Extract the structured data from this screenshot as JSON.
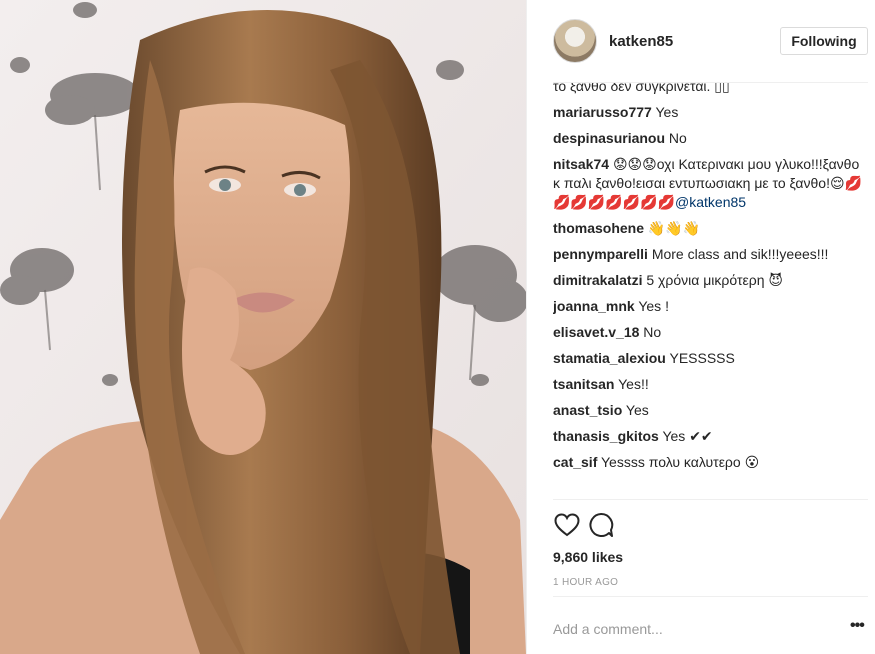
{
  "header": {
    "username": "katken85",
    "follow_label": "Following",
    "avatar": "avatar"
  },
  "comments": [
    {
      "author": "",
      "text": "το ξανθό δεν συγκρίνεται. ▯▯"
    },
    {
      "author": "mariarusso777",
      "text": "Yes"
    },
    {
      "author": "despinasurianou",
      "text": "No"
    },
    {
      "author": "nitsak74",
      "text": "😟😟😟οχι Κατερινακι μου γλυκο!!!ξανθο κ παλι ξανθο!εισαι εντυπωσιακη με το ξανθο!😌💋💋💋💋💋💋💋💋",
      "mention": "@katken85"
    },
    {
      "author": "thomasohene",
      "text": "👋👋👋"
    },
    {
      "author": "pennymparelli",
      "text": "More class and sik!!!yeees!!!"
    },
    {
      "author": "dimitrakalatzi",
      "text": "5 χρόνια μικρότερη 😈"
    },
    {
      "author": "joanna_mnk",
      "text": "Yes !"
    },
    {
      "author": "elisavet.v_18",
      "text": "No"
    },
    {
      "author": "stamatia_alexiou",
      "text": "YESSSSS"
    },
    {
      "author": "tsanitsan",
      "text": "Yes!!"
    },
    {
      "author": "anast_tsio",
      "text": "Yes"
    },
    {
      "author": "thanasis_gkitos",
      "text": "Yes ✔✔"
    },
    {
      "author": "cat_sif",
      "text": "Yessss πολυ καλυτερο 😮"
    }
  ],
  "actions": {
    "like_icon": "heart-icon",
    "comment_icon": "comment-bubble-icon"
  },
  "likes": "9,860 likes",
  "time": "1 HOUR AGO",
  "add_comment": {
    "placeholder": "Add a comment..."
  },
  "more_label": "•••",
  "colors": {
    "text": "#262626",
    "muted": "#999999",
    "link": "#003569",
    "border": "#efefef"
  }
}
